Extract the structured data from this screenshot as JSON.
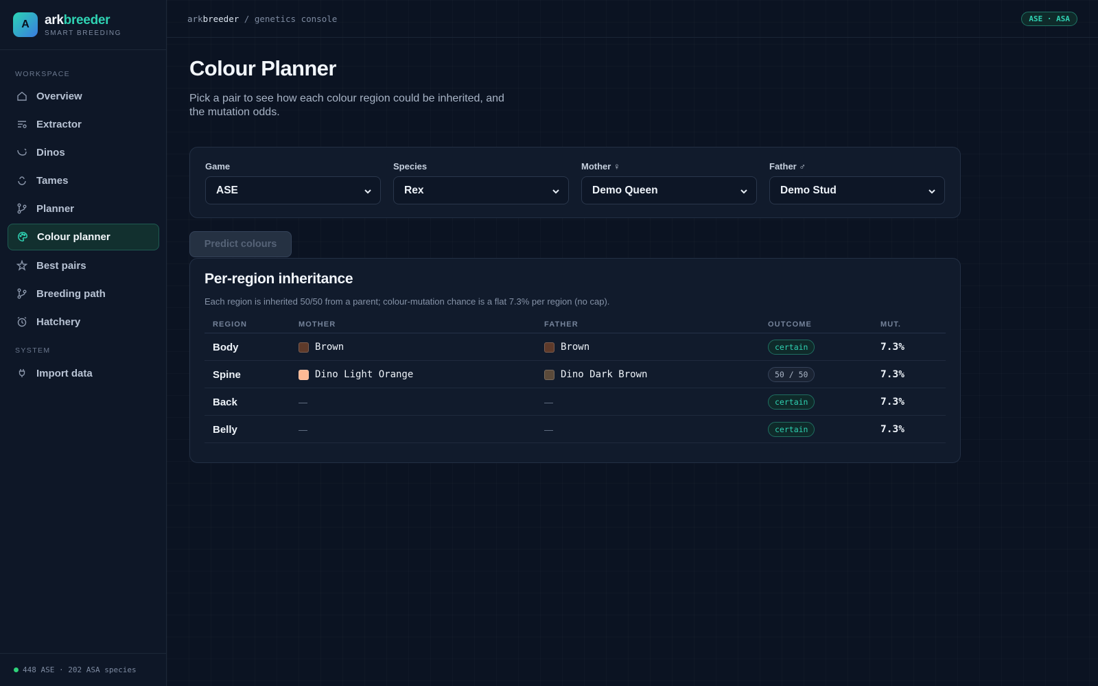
{
  "brand": {
    "logo_letter": "A",
    "name_prefix": "ark",
    "name_accent": "breeder",
    "tagline": "SMART BREEDING",
    "accent_color": "#2fd2b3"
  },
  "sidebar": {
    "workspace_label": "WORKSPACE",
    "system_label": "SYSTEM",
    "items": [
      {
        "label": "Overview",
        "icon": "home-icon"
      },
      {
        "label": "Extractor",
        "icon": "sliders-icon"
      },
      {
        "label": "Dinos",
        "icon": "dino-icon"
      },
      {
        "label": "Tames",
        "icon": "tame-icon"
      },
      {
        "label": "Planner",
        "icon": "branch-icon"
      },
      {
        "label": "Colour planner",
        "icon": "palette-icon",
        "active": true
      },
      {
        "label": "Best pairs",
        "icon": "sparkle-icon"
      },
      {
        "label": "Breeding path",
        "icon": "branch-icon"
      },
      {
        "label": "Hatchery",
        "icon": "clock-icon"
      }
    ],
    "system_items": [
      {
        "label": "Import data",
        "icon": "plug-icon"
      }
    ],
    "footer": "448 ASE · 202 ASA species",
    "footer_status_color": "#2fd27a"
  },
  "topbar": {
    "crumb_ark": "ark",
    "crumb_breeder": "breeder",
    "crumb_sep": "/",
    "crumb_page": "genetics console",
    "badge": "ASE · ASA"
  },
  "page": {
    "title": "Colour Planner",
    "subtitle": "Pick a pair to see how each colour region could be inherited, and the mutation odds."
  },
  "selectors": {
    "game": {
      "label": "Game",
      "value": "ASE"
    },
    "species": {
      "label": "Species",
      "value": "Rex"
    },
    "mother": {
      "label": "Mother ♀",
      "value": "Demo Queen"
    },
    "father": {
      "label": "Father ♂",
      "value": "Demo Stud"
    }
  },
  "predict_button": "Predict colours",
  "results": {
    "title": "Per-region inheritance",
    "description": "Each region is inherited 50/50 from a parent; colour-mutation chance is a flat 7.3% per region (no cap).",
    "columns": [
      "REGION",
      "MOTHER",
      "FATHER",
      "OUTCOME",
      "MUT."
    ],
    "rows": [
      {
        "region": "Body",
        "mother": "Brown",
        "mother_color": "#5e3a2a",
        "father": "Brown",
        "father_color": "#5e3a2a",
        "outcome": "certain",
        "mut": "7.3%"
      },
      {
        "region": "Spine",
        "mother": "Dino Light Orange",
        "mother_color": "#fdb995",
        "father": "Dino Dark Brown",
        "father_color": "#5b4a3a",
        "outcome": "50 / 50",
        "mut": "7.3%"
      },
      {
        "region": "Back",
        "mother": "—",
        "father": "—",
        "outcome": "certain",
        "mut": "7.3%"
      },
      {
        "region": "Belly",
        "mother": "—",
        "father": "—",
        "outcome": "certain",
        "mut": "7.3%"
      }
    ]
  }
}
